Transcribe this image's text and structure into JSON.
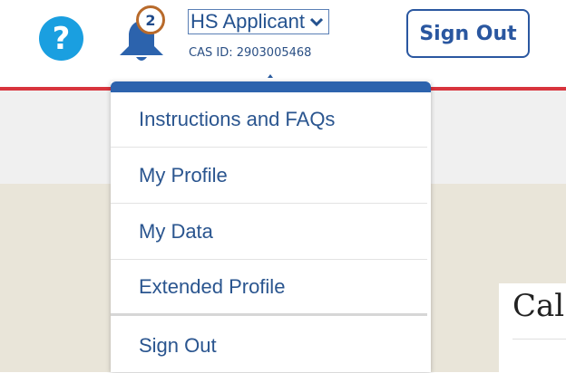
{
  "header": {
    "help_icon": "?",
    "notification_count": "2",
    "user_name": "HS Applicant",
    "cas_id": "CAS ID: 2903005468",
    "sign_out_label": "Sign Out"
  },
  "dropdown": {
    "items": [
      {
        "label": "Instructions and FAQs"
      },
      {
        "label": "My Profile"
      },
      {
        "label": "My Data"
      },
      {
        "label": "Extended Profile"
      },
      {
        "label": "Sign Out"
      }
    ]
  },
  "main": {
    "partial_heading": "Cal"
  },
  "colors": {
    "accent_blue": "#2d63ad",
    "help_blue": "#1a9fe0",
    "header_red": "#d8343d",
    "badge_border": "#b86a2b"
  }
}
